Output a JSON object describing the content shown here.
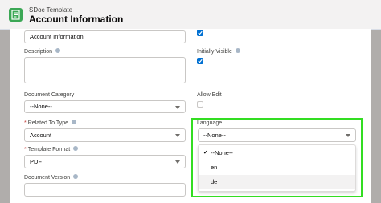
{
  "header": {
    "subtitle": "SDoc Template",
    "title": "Account Information"
  },
  "form": {
    "name_value": "Account Information",
    "description_label": "Description",
    "initially_visible_label": "Initially Visible",
    "document_category_label": "Document Category",
    "document_category_value": "--None--",
    "allow_edit_label": "Allow Edit",
    "related_to_type_label": "Related To Type",
    "related_to_type_value": "Account",
    "template_format_label": "Template Format",
    "template_format_value": "PDF",
    "document_version_label": "Document Version",
    "required_marker": "*"
  },
  "language": {
    "label": "Language",
    "value": "--None--",
    "options": [
      "--None--",
      "en",
      "de"
    ],
    "checked_option": "--None--",
    "hovered_option": "de"
  },
  "colors": {
    "brand_icon": "#3ba755",
    "checkbox_on": "#0070d2",
    "highlight": "#33dd22",
    "required": "#c23934"
  },
  "icons": {
    "header": "document-template-icon",
    "info": "info-icon",
    "check": "checkmark-icon"
  }
}
